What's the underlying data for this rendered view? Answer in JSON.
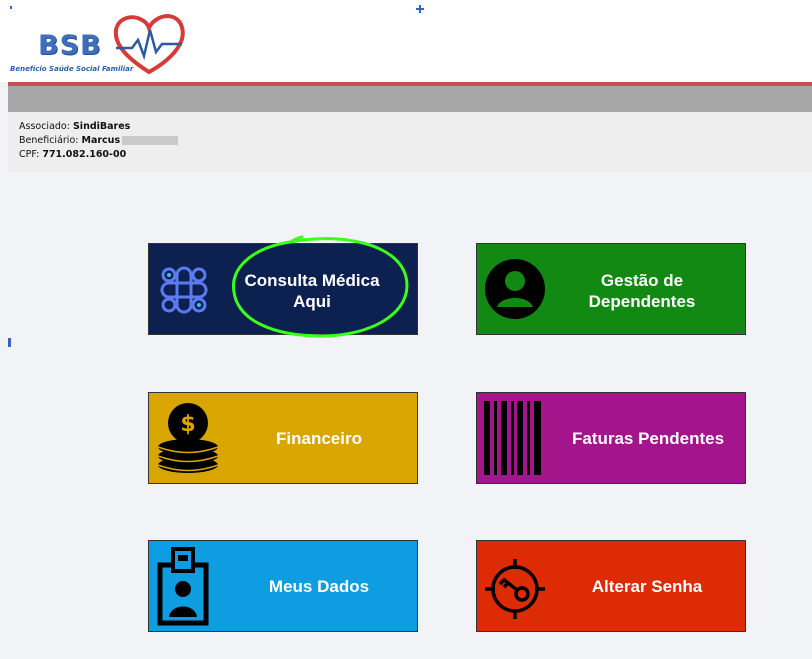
{
  "logo": {
    "title": "BSB",
    "subtitle": "Benefício Saúde Social Familiar"
  },
  "info": {
    "associado_label": "Associado:",
    "associado_value": "SindiBares",
    "beneficiario_label": "Beneficiário:",
    "beneficiario_value": "Marcus",
    "cpf_label": "CPF:",
    "cpf_value": "771.082.160-00"
  },
  "tiles": {
    "consulta": {
      "line1": "Consulta Médica",
      "line2": "Aqui",
      "color": "#0d2150",
      "icon": "medical-cross-icon"
    },
    "gestao": {
      "line1": "Gestão de",
      "line2": "Dependentes",
      "color": "#128912",
      "icon": "person-icon"
    },
    "financeiro": {
      "label": "Financeiro",
      "color": "#d9a500",
      "icon": "coins-icon"
    },
    "faturas": {
      "label": "Faturas Pendentes",
      "color": "#a4148a",
      "icon": "barcode-icon"
    },
    "dados": {
      "label": "Meus Dados",
      "color": "#0e9de0",
      "icon": "id-badge-icon"
    },
    "senha": {
      "label": "Alterar Senha",
      "color": "#dd2b05",
      "icon": "key-target-icon"
    }
  },
  "colors": {
    "accent_red": "#c84f55",
    "highlight_green": "#3dff1a"
  }
}
